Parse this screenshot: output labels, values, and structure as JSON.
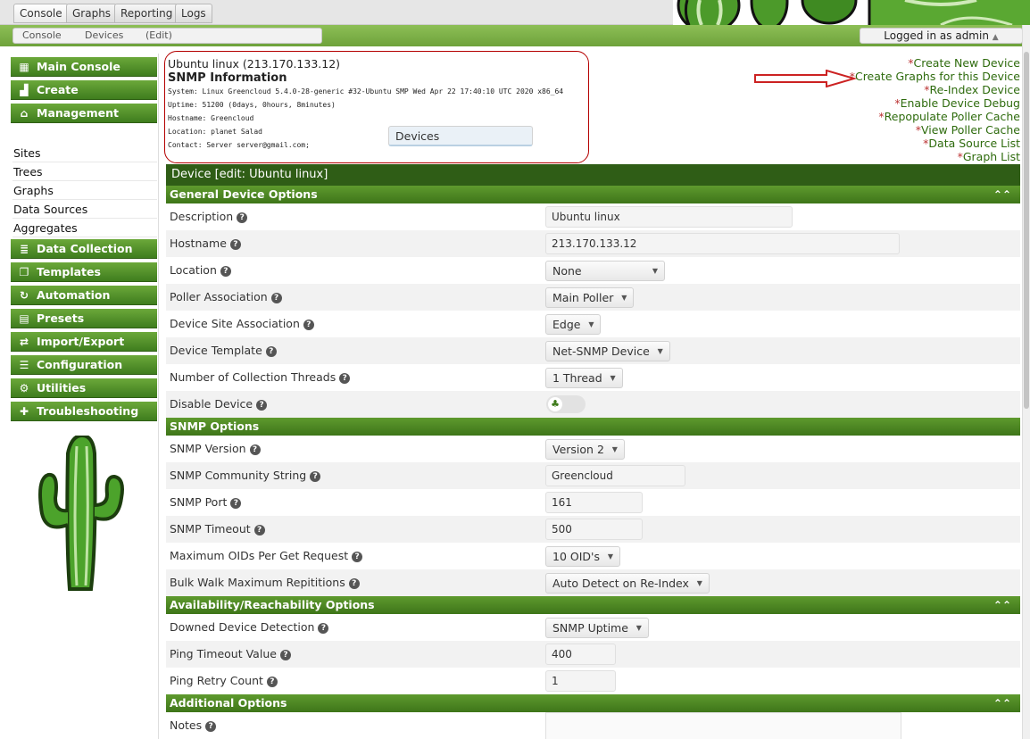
{
  "top_tabs": [
    "Console",
    "Graphs",
    "Reporting",
    "Logs"
  ],
  "breadcrumb": [
    "Console",
    "Devices",
    "(Edit)"
  ],
  "logged_in": "Logged in as admin",
  "logged_in_caret": "▲",
  "sidebar": {
    "main_console": "Main Console",
    "create": "Create",
    "management": "Management",
    "management_items": [
      "Devices",
      "Sites",
      "Trees",
      "Graphs",
      "Data Sources",
      "Aggregates"
    ],
    "data_collection": "Data Collection",
    "templates": "Templates",
    "automation": "Automation",
    "presets": "Presets",
    "import_export": "Import/Export",
    "configuration": "Configuration",
    "utilities": "Utilities",
    "troubleshooting": "Troubleshooting"
  },
  "info": {
    "title": "Ubuntu linux (213.170.133.12)",
    "snmp_heading": "SNMP Information",
    "system": "System: Linux Greencloud 5.4.0-28-generic #32-Ubuntu SMP Wed Apr 22 17:40:10 UTC 2020 x86_64",
    "uptime": "Uptime: 51200 (0days, 0hours, 8minutes)",
    "hostname": "Hostname: Greencloud",
    "location": "Location: planet Salad",
    "contact": "Contact: Server server@gmail.com;"
  },
  "actions": [
    "Create New Device",
    "Create Graphs for this Device",
    "Re-Index Device",
    "Enable Device Debug",
    "Repopulate Poller Cache",
    "View Poller Cache",
    "Data Source List",
    "Graph List"
  ],
  "action_marker": "*",
  "device_header": "Device [edit: Ubuntu linux]",
  "sections": {
    "general": "General Device Options",
    "snmp": "SNMP Options",
    "availability": "Availability/Reachability Options",
    "additional": "Additional Options"
  },
  "collapse_glyph": "⌃⌃",
  "help_glyph": "?",
  "fields": {
    "description": {
      "label": "Description",
      "value": "Ubuntu linux"
    },
    "hostname": {
      "label": "Hostname",
      "value": "213.170.133.12"
    },
    "location": {
      "label": "Location",
      "value": "None"
    },
    "poller": {
      "label": "Poller Association",
      "value": "Main Poller"
    },
    "site": {
      "label": "Device Site Association",
      "value": "Edge"
    },
    "template": {
      "label": "Device Template",
      "value": "Net-SNMP Device"
    },
    "threads": {
      "label": "Number of Collection Threads",
      "value": "1 Thread"
    },
    "disable": {
      "label": "Disable Device",
      "checked": false
    },
    "snmp_version": {
      "label": "SNMP Version",
      "value": "Version 2"
    },
    "community": {
      "label": "SNMP Community String",
      "value": "Greencloud"
    },
    "snmp_port": {
      "label": "SNMP Port",
      "value": "161"
    },
    "snmp_timeout": {
      "label": "SNMP Timeout",
      "value": "500"
    },
    "max_oids": {
      "label": "Maximum OIDs Per Get Request",
      "value": "10 OID's"
    },
    "bulk_walk": {
      "label": "Bulk Walk Maximum Repititions",
      "value": "Auto Detect on Re-Index"
    },
    "downed": {
      "label": "Downed Device Detection",
      "value": "SNMP Uptime"
    },
    "ping_timeout": {
      "label": "Ping Timeout Value",
      "value": "400"
    },
    "ping_retry": {
      "label": "Ping Retry Count",
      "value": "1"
    },
    "notes": {
      "label": "Notes",
      "value": ""
    }
  },
  "colors": {
    "brand_green": "#3f7d1e",
    "highlight_red": "#b40000",
    "link_green": "#2e6b0d"
  }
}
